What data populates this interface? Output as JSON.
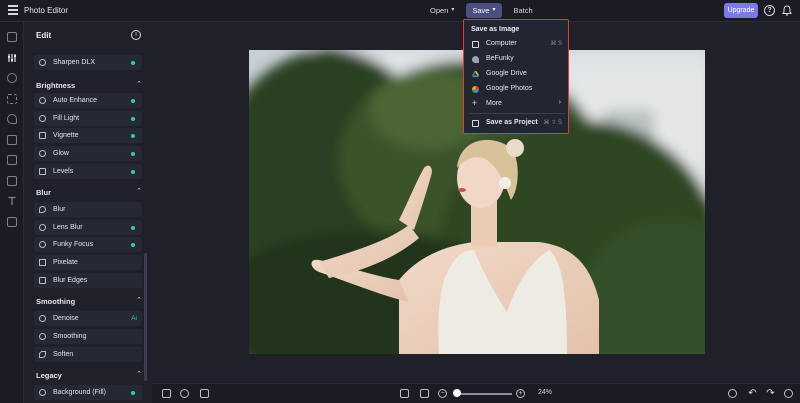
{
  "app": {
    "title": "Photo Editor"
  },
  "topbar": {
    "open_label": "Open",
    "save_label": "Save",
    "batch_label": "Batch",
    "upgrade_label": "Upgrade",
    "help_glyph": "?"
  },
  "panel": {
    "title": "Edit",
    "info_glyph": "i",
    "sections": [
      {
        "name": "Brightness"
      },
      {
        "name": "Blur"
      },
      {
        "name": "Smoothing"
      },
      {
        "name": "Legacy"
      }
    ],
    "items": [
      {
        "label": "Sharpen DLX",
        "icon": "sharpen-icon",
        "badge": "dot"
      },
      {
        "label": "Auto Enhance",
        "icon": "magic-wand-icon",
        "badge": "dot"
      },
      {
        "label": "Fill Light",
        "icon": "sun-icon",
        "badge": "dot"
      },
      {
        "label": "Vignette",
        "icon": "vignette-icon",
        "badge": "dot"
      },
      {
        "label": "Glow",
        "icon": "glow-icon",
        "badge": "dot"
      },
      {
        "label": "Levels",
        "icon": "levels-icon",
        "badge": "dot"
      },
      {
        "label": "Blur",
        "icon": "drop-icon",
        "badge": "none"
      },
      {
        "label": "Lens Blur",
        "icon": "lens-icon",
        "badge": "dot"
      },
      {
        "label": "Funky Focus",
        "icon": "focus-icon",
        "badge": "dot"
      },
      {
        "label": "Pixelate",
        "icon": "pixelate-icon",
        "badge": "none"
      },
      {
        "label": "Blur Edges",
        "icon": "blur-edges-icon",
        "badge": "none"
      },
      {
        "label": "Denoise",
        "icon": "denoise-icon",
        "badge": "AI",
        "badge_text": "Ai"
      },
      {
        "label": "Smoothing",
        "icon": "smoothing-icon",
        "badge": "none"
      },
      {
        "label": "Soften",
        "icon": "brush-icon",
        "badge": "none"
      },
      {
        "label": "Background (Fill)",
        "icon": "fill-icon",
        "badge": "dot"
      }
    ]
  },
  "bottombar": {
    "zoom_label": "24%",
    "zoom_level": 0.24
  },
  "save_menu": {
    "heading": "Save as Image",
    "items": [
      {
        "label": "Computer",
        "shortcut": "⌘ S",
        "icon": "computer-icon"
      },
      {
        "label": "BeFunky",
        "shortcut": "",
        "icon": "befunky-icon"
      },
      {
        "label": "Google Drive",
        "shortcut": "",
        "icon": "google-drive-icon"
      },
      {
        "label": "Google Photos",
        "shortcut": "",
        "icon": "google-photos-icon"
      },
      {
        "label": "More",
        "shortcut": "",
        "icon": "plus-icon"
      },
      {
        "label": "Save as Project",
        "shortcut": "⌘ ⇧ S",
        "icon": "project-icon"
      }
    ]
  },
  "colors": {
    "accent": "#7c79e8",
    "highlight_border": "#e03a3a",
    "status_dot": "#35c8a8",
    "background": "#1f2029"
  }
}
